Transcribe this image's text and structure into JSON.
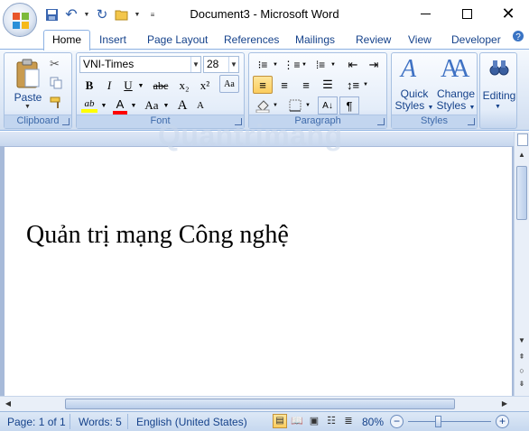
{
  "title": "Document3 - Microsoft Word",
  "tabs": [
    "Home",
    "Insert",
    "Page Layout",
    "References",
    "Mailings",
    "Review",
    "View",
    "Developer"
  ],
  "clipboard": {
    "paste": "Paste",
    "label": "Clipboard"
  },
  "font": {
    "name": "VNI-Times",
    "size": "28",
    "label": "Font",
    "bold": "B",
    "italic": "I",
    "underline": "U",
    "strike": "abc",
    "sub": "x₂",
    "sup": "x²",
    "highlight": "ab",
    "color_a": "A",
    "change_case": "Aa",
    "grow": "A",
    "shrink": "A"
  },
  "paragraph": {
    "label": "Paragraph"
  },
  "styles": {
    "quick_1": "Quick",
    "quick_2": "Styles",
    "change_1": "Change",
    "change_2": "Styles",
    "label": "Styles"
  },
  "editing": {
    "label": "Editing"
  },
  "document": {
    "text": "Quản trị mạng Công nghệ"
  },
  "watermark": "Quantrimang",
  "status": {
    "page": "Page: 1 of 1",
    "words": "Words: 5",
    "language": "English (United States)",
    "zoom": "80%"
  },
  "colors": {
    "accent": "#15428b",
    "ribbon": "#dbe6f5",
    "highlight": "#ffff00",
    "font_color": "#ff0000"
  }
}
